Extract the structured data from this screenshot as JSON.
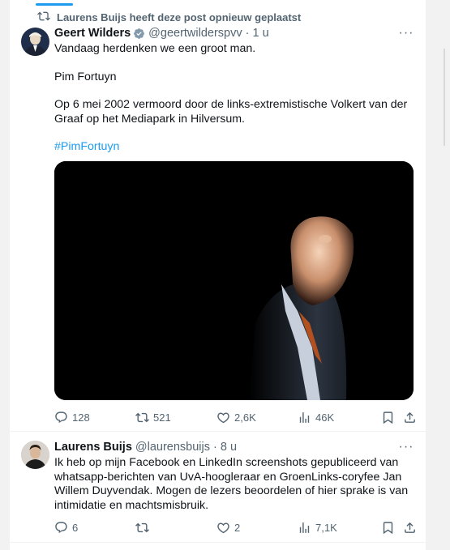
{
  "repost_banner": {
    "text": "Laurens Buijs heeft deze post opnieuw geplaatst"
  },
  "tweets": [
    {
      "name": "Geert Wilders",
      "handle": "@geertwilderspvv",
      "time": "· 1 u",
      "verified": true,
      "text_lines": [
        "Vandaag herdenken we een groot man.",
        "Pim Fortuyn",
        "Op 6 mei 2002 vermoord door de links-extremistische Volkert van der Graaf op het Mediapark in Hilversum."
      ],
      "hashtag": "#PimFortuyn",
      "stats": {
        "replies": "128",
        "reposts": "521",
        "likes": "2,6K",
        "views": "46K"
      }
    },
    {
      "name": "Laurens Buijs",
      "handle": "@laurensbuijs",
      "time": "· 8 u",
      "verified": false,
      "text": "Ik heb op mijn Facebook en LinkedIn screenshots gepubliceerd van whatsapp-berichten van UvA-hoogleraar en GroenLinks-coryfee Jan Willem Duyvendak. Mogen de lezers beoordelen of hier sprake is van intimidatie en machtsmisbruik.",
      "stats": {
        "replies": "6",
        "reposts": "",
        "likes": "2",
        "views": "7,1K"
      }
    }
  ],
  "icons": {
    "repost": "repost-icon",
    "verified": "verified-badge-icon",
    "more": "more-icon",
    "reply": "reply-icon",
    "like": "like-icon",
    "views": "views-icon",
    "bookmark": "bookmark-icon",
    "share": "share-icon"
  },
  "colors": {
    "link": "#1d9bf0",
    "secondary": "#536471",
    "text": "#0f1419"
  }
}
